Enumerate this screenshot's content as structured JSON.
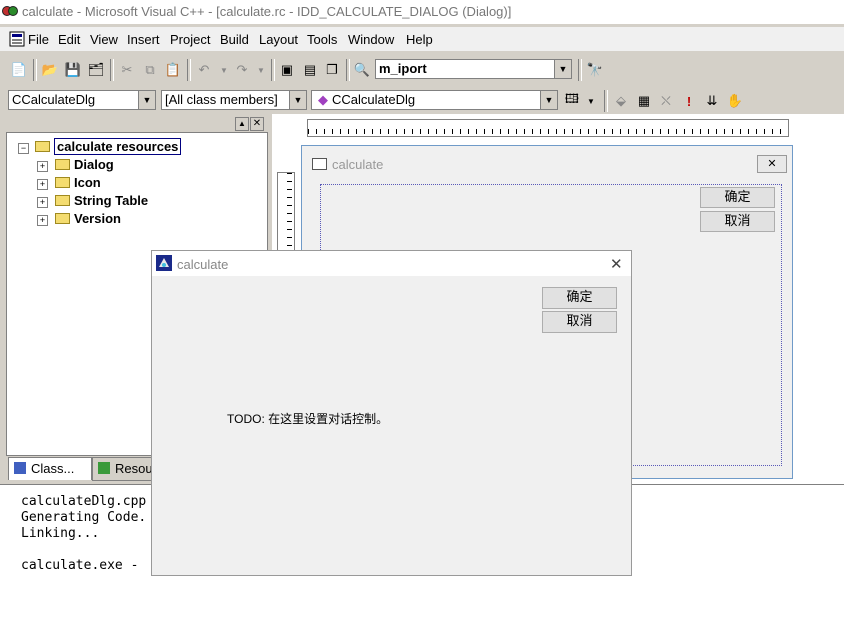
{
  "window": {
    "title": "calculate - Microsoft Visual C++ - [calculate.rc - IDD_CALCULATE_DIALOG (Dialog)]"
  },
  "menu": {
    "items": [
      "File",
      "Edit",
      "View",
      "Insert",
      "Project",
      "Build",
      "Layout",
      "Tools",
      "Window",
      "Help"
    ]
  },
  "toolbar": {
    "find_combo_value": "m_iport"
  },
  "wizardbar": {
    "class_combo": "CCalculateDlg",
    "filter_combo": "[All class members]",
    "member_combo": "CCalculateDlg"
  },
  "workspace": {
    "root_label": "calculate resources",
    "folders": [
      "Dialog",
      "Icon",
      "String Table",
      "Version"
    ],
    "tabs": [
      "Class...",
      "Resou"
    ]
  },
  "design_dialog": {
    "title": "calculate",
    "ok_label": "确定",
    "cancel_label": "取消"
  },
  "output": {
    "lines": [
      "calculateDlg.cpp",
      "Generating Code.",
      "Linking...",
      "",
      "calculate.exe - "
    ]
  },
  "running_dialog": {
    "title": "calculate",
    "ok_label": "确定",
    "cancel_label": "取消",
    "todo_text": "TODO: 在这里设置对话控制。"
  }
}
